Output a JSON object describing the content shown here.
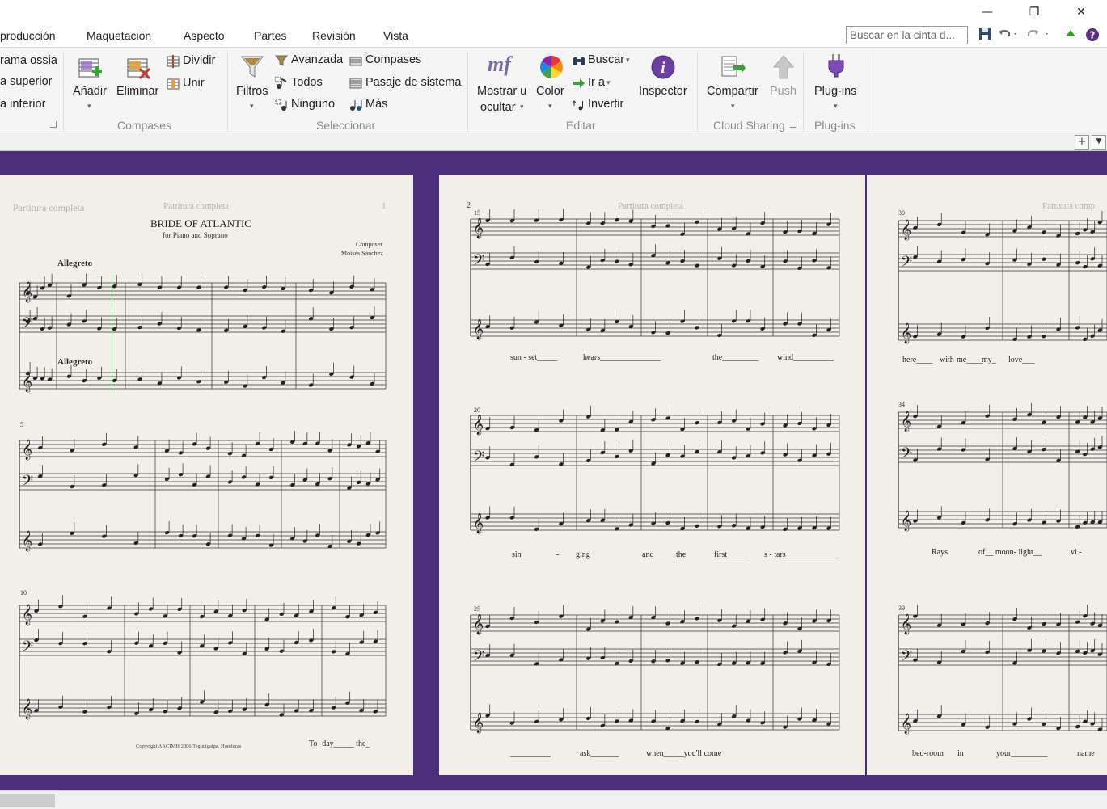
{
  "window": {
    "minimize": "—",
    "restore": "❐",
    "close": "✕"
  },
  "tabs": [
    "producción",
    "Maquetación",
    "Aspecto",
    "Partes",
    "Revisión",
    "Vista"
  ],
  "search": {
    "placeholder": "Buscar en la cinta d..."
  },
  "ribbon": {
    "partial_group": {
      "items": [
        "rama ossia",
        "a superior",
        "a inferior"
      ]
    },
    "compases": {
      "name": "Compases",
      "add": "Añadir",
      "remove": "Eliminar",
      "split": "Dividir",
      "join": "Unir"
    },
    "seleccionar": {
      "name": "Seleccionar",
      "filters": "Filtros",
      "advanced": "Avanzada",
      "all": "Todos",
      "none": "Ninguno",
      "bars": "Compases",
      "system_passage": "Pasaje de sistema",
      "more": "Más"
    },
    "editar": {
      "name": "Editar",
      "show_hide_1": "Mostrar u",
      "show_hide_2": "ocultar",
      "color": "Color",
      "find": "Buscar",
      "goto": "Ir a",
      "invert": "Invertir",
      "inspector": "Inspector",
      "mf_glyph": "mf"
    },
    "cloud": {
      "name": "Cloud Sharing",
      "share": "Compartir",
      "push": "Push"
    },
    "plugins": {
      "name": "Plug-ins",
      "plugins": "Plug-ins"
    }
  },
  "strip": {
    "add": "+",
    "menu": "▼"
  },
  "score": {
    "page1": {
      "header_left": "Partitura completa",
      "header_center": "Partitura completa",
      "page_number": "1",
      "title": "BRIDE OF ATLANTIC",
      "subtitle": "for Piano and Soprano",
      "composer_label": "Composer",
      "composer_name": "Moisés Sánchez",
      "tempo": "Allegreto",
      "tempo2": "Allegreto",
      "copyright": "Copyright AACIMH 2006 Tegucigalpa, Honduras",
      "measure_5": "5",
      "measure_10": "10",
      "lyrics": "To  -day_____  the_"
    },
    "page2": {
      "header": "Partitura completa",
      "page_number": "2",
      "m15": "15",
      "m20": "20",
      "m25": "25",
      "lyrics1": [
        "sun - set_____",
        "hears_______________",
        "the_________",
        "wind__________"
      ],
      "lyrics2": [
        "sin",
        "-",
        "ging",
        "and",
        "the",
        "first_____",
        "s - tars_____________"
      ],
      "lyrics3": [
        "__________",
        "ask_______",
        "when_____you'll come"
      ]
    },
    "page3": {
      "header": "Partitura comp",
      "m30": "30",
      "m34": "34",
      "m39": "39",
      "lyrics1": [
        "here____",
        "with",
        "me____",
        "my_",
        "love___"
      ],
      "lyrics2": [
        "Rays",
        "of__ moon- light__",
        "vi -"
      ],
      "lyrics3": [
        "bed-room",
        "in",
        "your_________",
        "name"
      ]
    }
  },
  "colors": {
    "score_bg": "#4b2f7c",
    "paper": "#f2efe9",
    "ribbon_bg": "#f5f5f5",
    "group_label": "#8a8a8a"
  }
}
